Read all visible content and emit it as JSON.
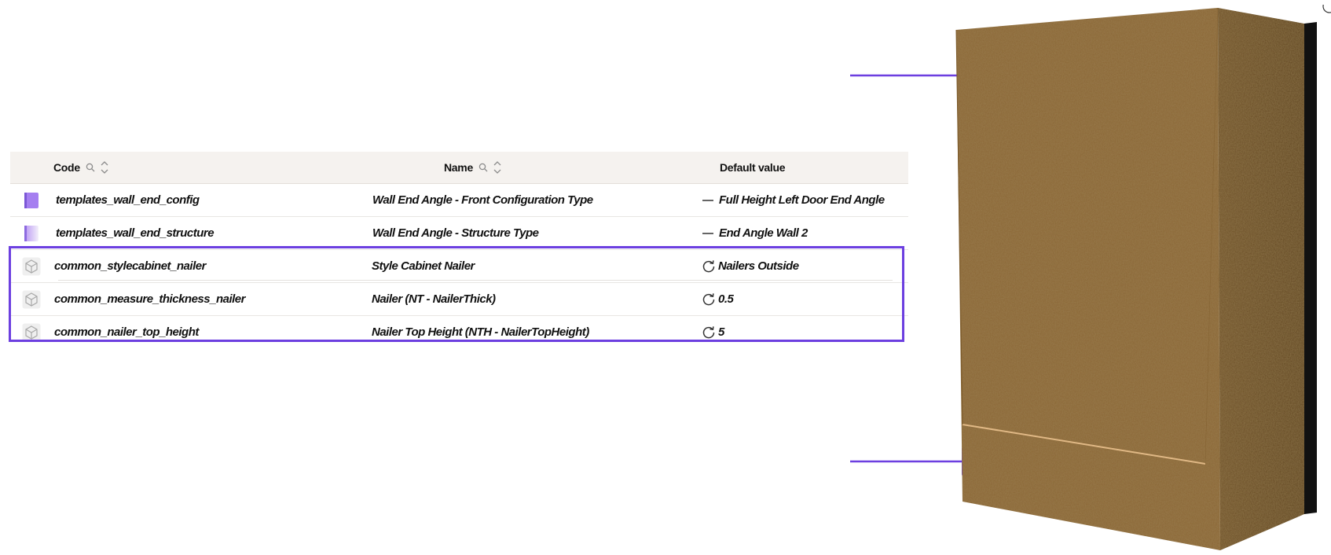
{
  "table": {
    "headers": {
      "code": "Code",
      "name": "Name",
      "default_value": "Default value"
    },
    "rows": [
      {
        "code": "templates_wall_end_config",
        "name": "Wall End Angle - Front Configuration Type",
        "value": "Full Height Left Door End Angle",
        "status_icon": "dash-icon",
        "type_icon": "purple-swatch-icon"
      },
      {
        "code": "templates_wall_end_structure",
        "name": "Wall End Angle - Structure Type",
        "value": "End Angle Wall 2",
        "status_icon": "dash-icon",
        "type_icon": "purple-gradient-swatch-icon"
      },
      {
        "code": "common_stylecabinet_nailer",
        "name": "Style Cabinet Nailer",
        "value": "Nailers Outside",
        "status_icon": "reset-icon",
        "type_icon": "cube-icon"
      },
      {
        "code": "common_measure_thickness_nailer",
        "name": "Nailer (NT - NailerThick)",
        "value": "0.5",
        "status_icon": "reset-icon",
        "type_icon": "cube-icon"
      },
      {
        "code": "common_nailer_top_height",
        "name": "Nailer Top Height (NTH - NailerTopHeight)",
        "value": "5",
        "status_icon": "reset-icon",
        "type_icon": "cube-icon"
      }
    ]
  },
  "colors": {
    "highlight": "#6c3fe0",
    "swatch_purple": "#a57ff0",
    "wood": "#8a6534",
    "header_bg": "#f5f2ef"
  },
  "annotations": {
    "arrow_icon": "right-arrow-icon",
    "image": "cabinet-3d-preview"
  }
}
